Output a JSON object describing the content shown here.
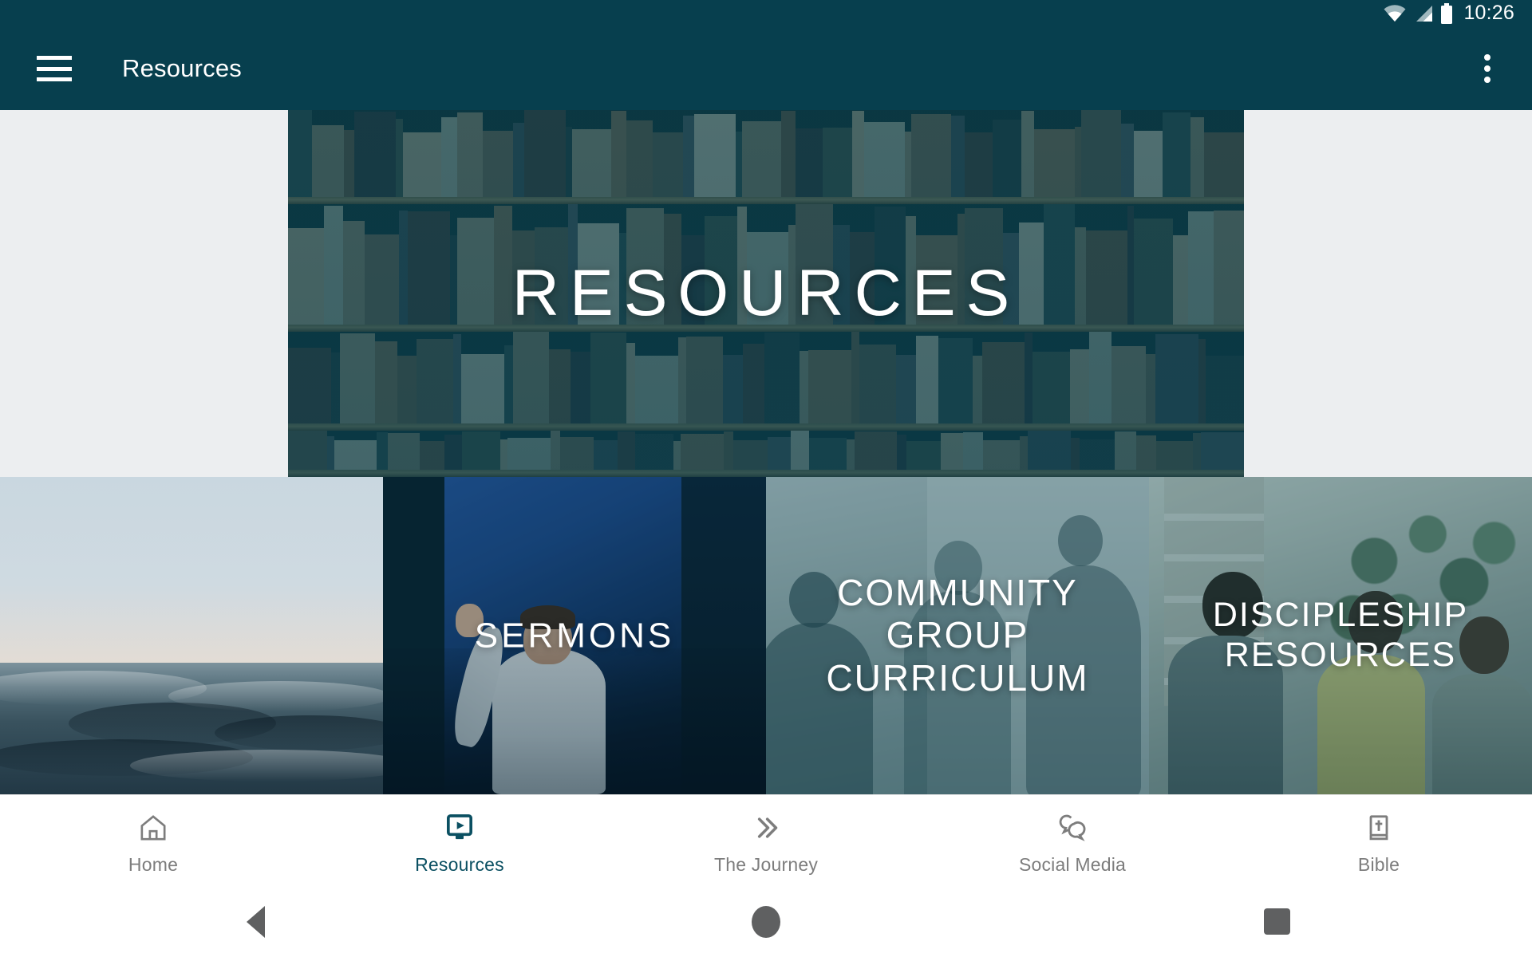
{
  "status_bar": {
    "time": "10:26",
    "icons": [
      "wifi-icon",
      "cellular-signal-icon",
      "battery-icon"
    ]
  },
  "app_bar": {
    "menu_icon": "hamburger-menu-icon",
    "title": "Resources",
    "overflow_icon": "overflow-menu-icon"
  },
  "hero": {
    "title": "RESOURCES",
    "image_description": "bookshelf-library-photo",
    "overlay_color": "#093e4d"
  },
  "tiles": [
    {
      "label": "",
      "name": "tile-ocean",
      "image_description": "ocean-waves-at-sunset-photo"
    },
    {
      "label": "SERMONS",
      "name": "tile-sermons",
      "image_description": "speaker-preaching-photo"
    },
    {
      "label": "COMMUNITY GROUP CURRICULUM",
      "name": "tile-community-group-curriculum",
      "image_description": "group-meeting-photo"
    },
    {
      "label": "DISCIPLESHIP RESOURCES",
      "name": "tile-discipleship-resources",
      "image_description": "young-people-talking-photo"
    }
  ],
  "bottom_nav": {
    "active_index": 1,
    "active_color": "#0b5062",
    "inactive_color": "#7d7d7d",
    "items": [
      {
        "label": "Home",
        "icon": "home-icon"
      },
      {
        "label": "Resources",
        "icon": "video-monitor-play-icon"
      },
      {
        "label": "The Journey",
        "icon": "double-chevron-right-icon"
      },
      {
        "label": "Social Media",
        "icon": "speech-bubbles-icon"
      },
      {
        "label": "Bible",
        "icon": "bible-book-cross-icon"
      }
    ]
  },
  "system_nav": {
    "back": "back-triangle-icon",
    "home": "home-circle-icon",
    "recents": "recents-square-icon"
  },
  "theme": {
    "primary": "#073f4e",
    "page_background": "#eceef0"
  }
}
